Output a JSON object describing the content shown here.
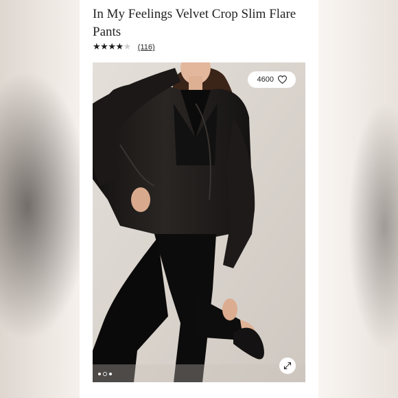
{
  "product": {
    "title": "In My Feelings Velvet Crop Slim Flare Pants",
    "rating": 4,
    "rating_max": 5,
    "review_count": "(116)"
  },
  "gallery": {
    "like_count": "4600",
    "image_count": 3,
    "active_image": 2
  },
  "icons": {
    "like": "heart-icon",
    "expand": "expand-arrows-icon"
  },
  "colors": {
    "card_background": "#ffffff",
    "text": "#222222",
    "star_filled": "#1c1c1c",
    "star_empty": "#cfcfcf"
  }
}
